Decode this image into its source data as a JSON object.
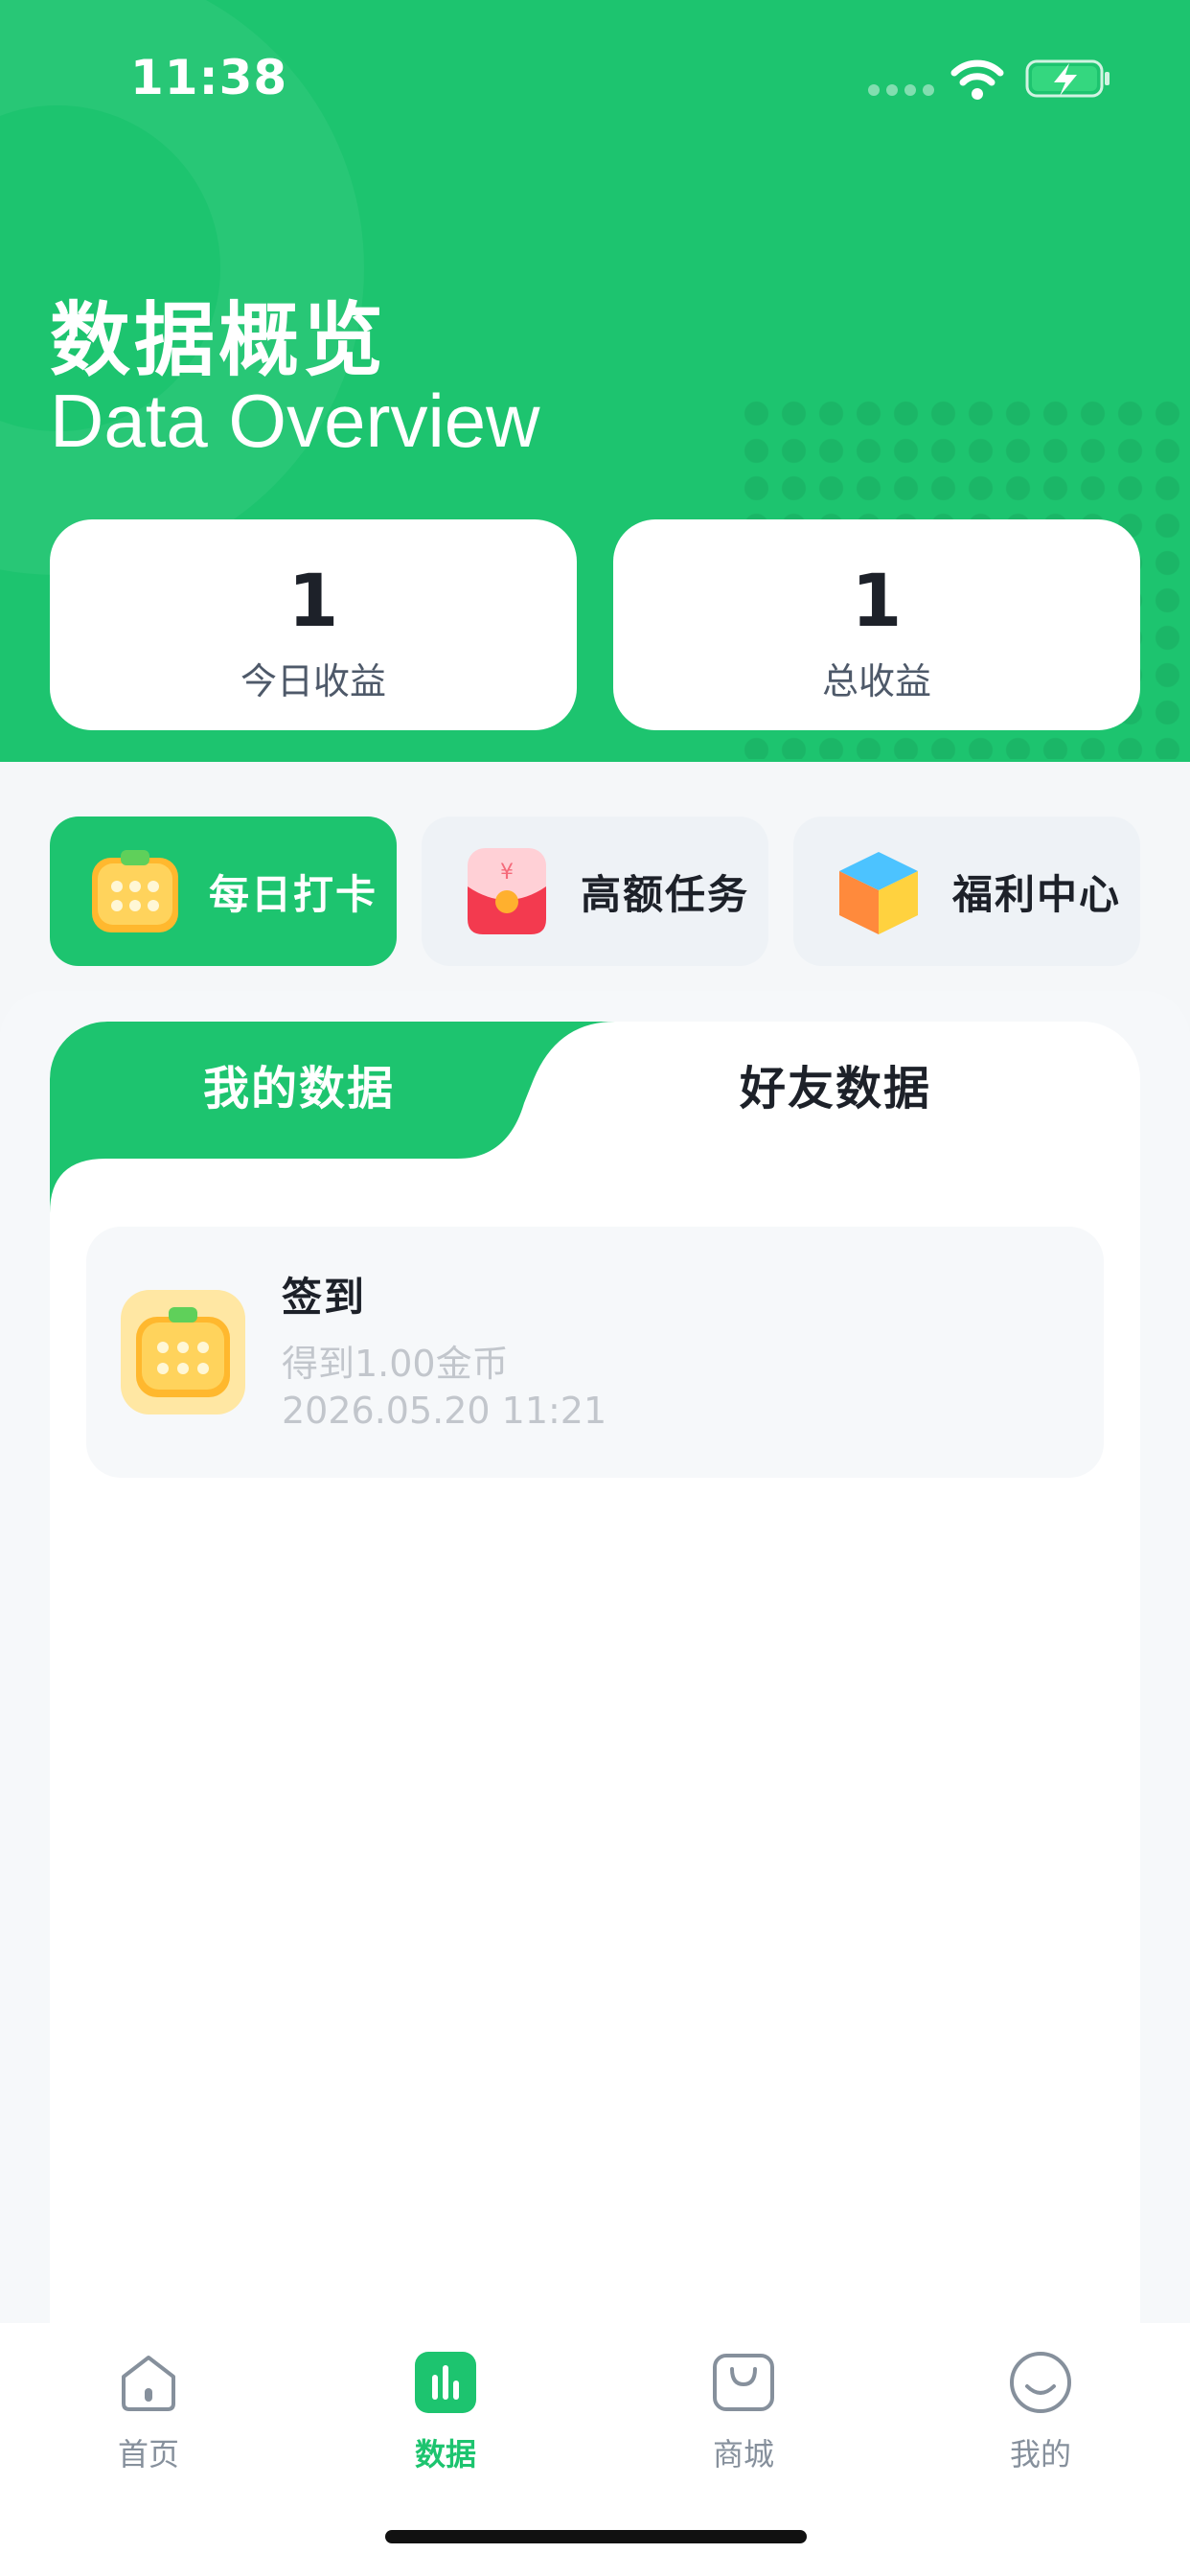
{
  "status_bar": {
    "time": "11:38"
  },
  "header": {
    "title_cn": "数据概览",
    "title_en": "Data Overview"
  },
  "stats": [
    {
      "value": "1",
      "label": "今日收益"
    },
    {
      "value": "1",
      "label": "总收益"
    }
  ],
  "quick_actions": [
    {
      "label": "每日打卡",
      "icon": "calendar-icon",
      "active": true
    },
    {
      "label": "高额任务",
      "icon": "red-envelope-icon",
      "active": false
    },
    {
      "label": "福利中心",
      "icon": "gift-cube-icon",
      "active": false
    }
  ],
  "tabs": [
    {
      "label": "我的数据",
      "active": true
    },
    {
      "label": "好友数据",
      "active": false
    }
  ],
  "records": [
    {
      "title": "签到",
      "desc": "得到1.00金币",
      "time": "2026.05.20 11:21",
      "icon": "calendar-icon"
    }
  ],
  "bottom_nav": [
    {
      "label": "首页",
      "icon": "home-icon",
      "active": false
    },
    {
      "label": "数据",
      "icon": "chart-icon",
      "active": true
    },
    {
      "label": "商城",
      "icon": "shopping-bag-icon",
      "active": false
    },
    {
      "label": "我的",
      "icon": "smile-face-icon",
      "active": false
    }
  ],
  "colors": {
    "brand": "#1dc46f",
    "text": "#1d2129",
    "muted": "#86909c",
    "faint": "#c2c6cc"
  }
}
